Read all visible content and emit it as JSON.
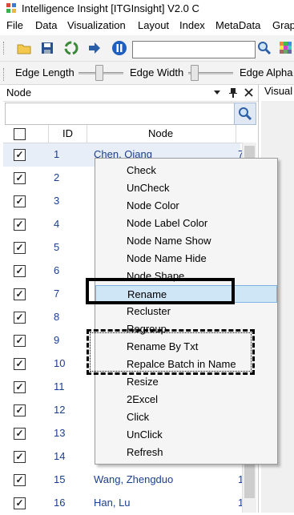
{
  "window": {
    "title": "Intelligence Insight [ITGInsight] V2.0 C"
  },
  "menu": [
    "File",
    "Data",
    "Visualization",
    "Layout",
    "Index",
    "MetaData",
    "Grap"
  ],
  "toolbar": {
    "icons": [
      "open-folder-icon",
      "save-icon",
      "recycle-icon",
      "import-arrow-icon",
      "pause-icon",
      "search-icon",
      "palette-icon"
    ],
    "search_value": ""
  },
  "sliders": {
    "edge_length": "Edge Length",
    "edge_width": "Edge Width",
    "edge_alpha": "Edge Alpha"
  },
  "panel": {
    "title": "Node",
    "side_tab": "Visual",
    "filter_value": ""
  },
  "grid": {
    "columns": {
      "id": "ID",
      "node": "Node"
    },
    "rows": [
      {
        "id": "1",
        "name": "Chen, Qiang",
        "checked": true,
        "extra": "7"
      },
      {
        "id": "2",
        "name": "",
        "checked": true,
        "extra": ""
      },
      {
        "id": "3",
        "name": "",
        "checked": true,
        "extra": ""
      },
      {
        "id": "4",
        "name": "",
        "checked": true,
        "extra": ""
      },
      {
        "id": "5",
        "name": "",
        "checked": true,
        "extra": ""
      },
      {
        "id": "6",
        "name": "",
        "checked": true,
        "extra": ""
      },
      {
        "id": "7",
        "name": "",
        "checked": true,
        "extra": ""
      },
      {
        "id": "8",
        "name": "",
        "checked": true,
        "extra": ""
      },
      {
        "id": "9",
        "name": "",
        "checked": true,
        "extra": ""
      },
      {
        "id": "10",
        "name": "",
        "checked": true,
        "extra": ""
      },
      {
        "id": "11",
        "name": "",
        "checked": true,
        "extra": ""
      },
      {
        "id": "12",
        "name": "",
        "checked": true,
        "extra": ""
      },
      {
        "id": "13",
        "name": "",
        "checked": true,
        "extra": ""
      },
      {
        "id": "14",
        "name": "",
        "checked": true,
        "extra": ""
      },
      {
        "id": "15",
        "name": "Wang, Zhengduo",
        "checked": true,
        "extra": "1"
      },
      {
        "id": "16",
        "name": "Han, Lu",
        "checked": true,
        "extra": "1"
      }
    ]
  },
  "context_menu": {
    "items": [
      "Check",
      "UnCheck",
      "Node Color",
      "Node Label Color",
      "Node Name Show",
      "Node Name Hide",
      "Node Shape",
      "Rename",
      "Recluster",
      "Regroup",
      "Rename By Txt",
      "Repalce Batch in Name",
      "Resize",
      "2Excel",
      "Click",
      "UnClick",
      "Refresh"
    ],
    "highlighted": "Rename"
  },
  "colors": {
    "accent": "#1a3f8f",
    "highlight": "#cfe6f7"
  }
}
